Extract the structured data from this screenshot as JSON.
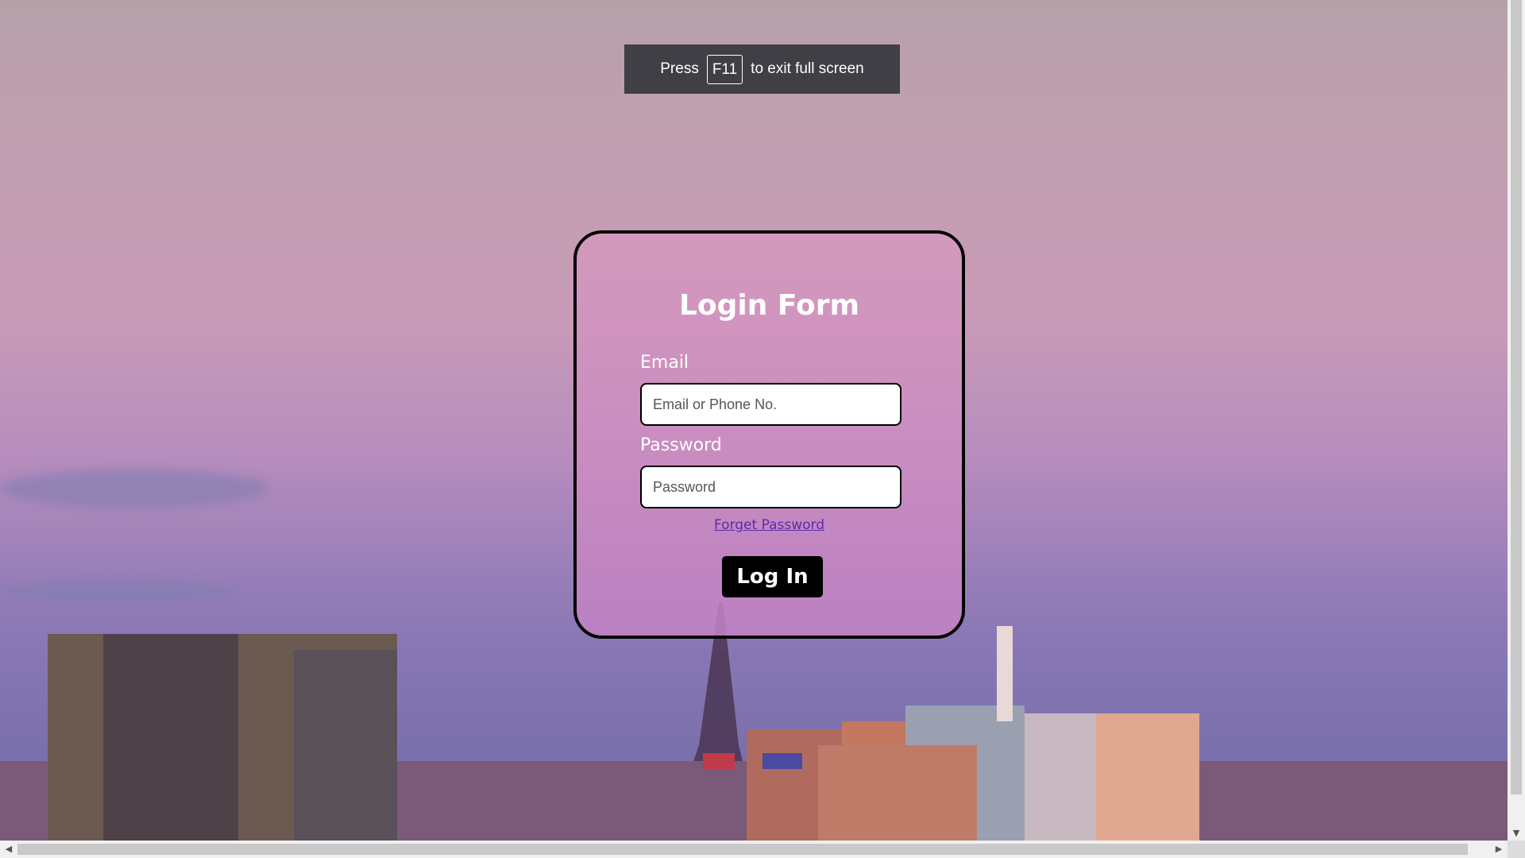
{
  "fullscreen_notice": {
    "prefix": "Press",
    "key": "F11",
    "suffix": "to exit full screen"
  },
  "login_form": {
    "title": "Login Form",
    "email_label": "Email",
    "email_placeholder": "Email or Phone No.",
    "password_label": "Password",
    "password_placeholder": "Password",
    "forgot_link": "Forget Password",
    "submit_label": "Log In"
  },
  "colors": {
    "card_border": "#000000",
    "button_bg": "#000000",
    "link": "#5b2aa8"
  },
  "icons": {
    "scroll_up": "triangle-up-icon",
    "scroll_down": "triangle-down-icon",
    "scroll_left": "triangle-left-icon",
    "scroll_right": "triangle-right-icon"
  }
}
